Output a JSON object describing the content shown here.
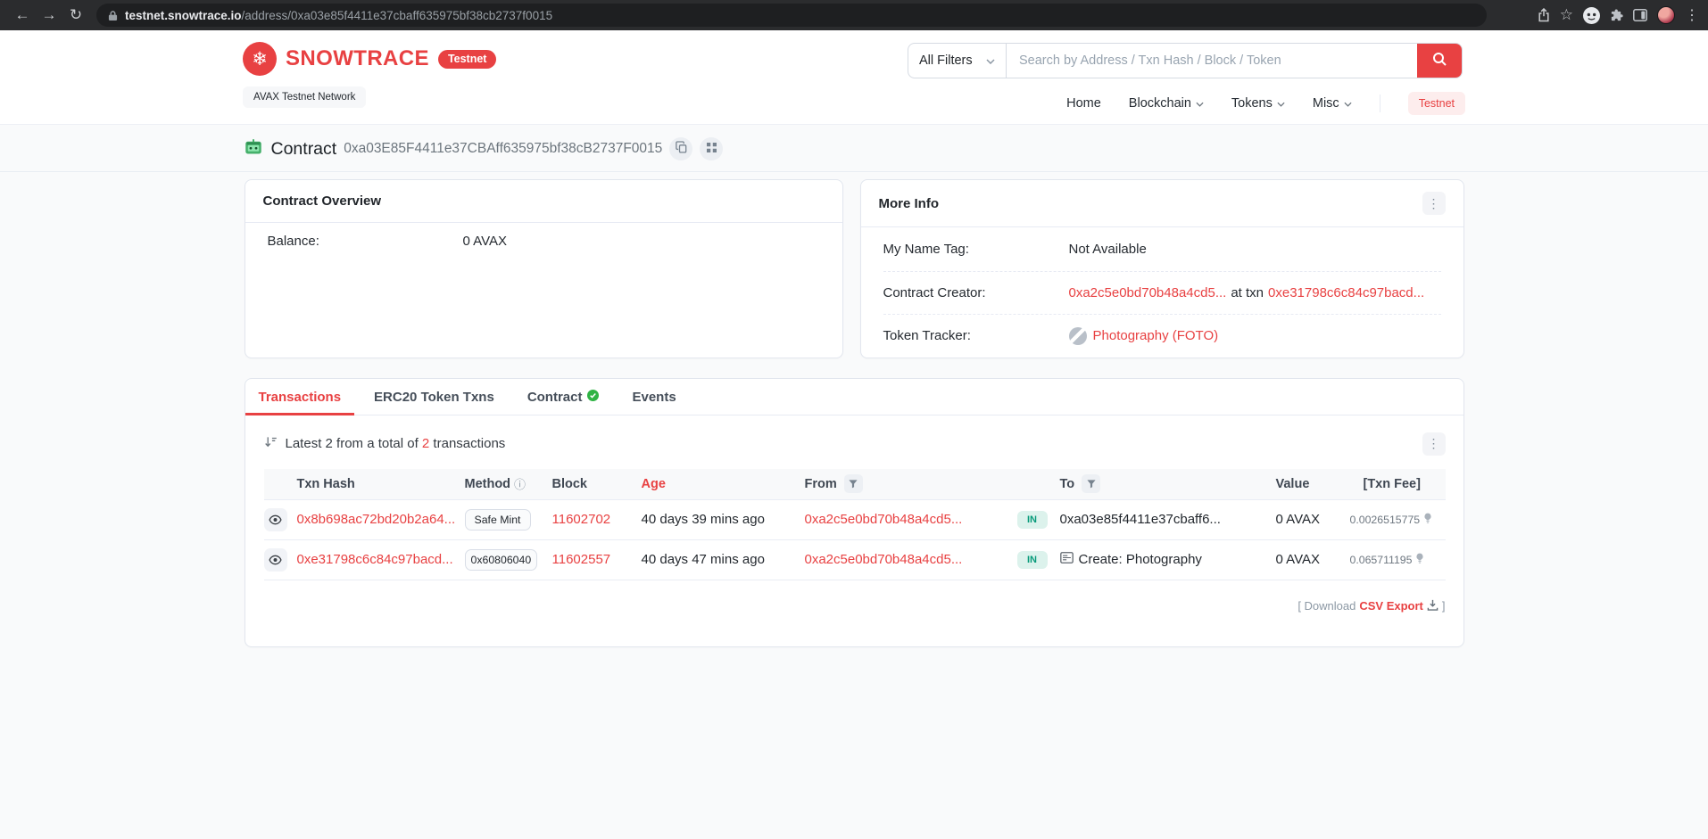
{
  "browser": {
    "url_domain": "testnet.snowtrace.io",
    "url_path": "/address/0xa03e85f4411e37cbaff635975bf38cb2737f0015"
  },
  "icons": {
    "back": "←",
    "forward": "→",
    "refresh": "↻",
    "star": "☆",
    "kebab": "⋮",
    "snowflake": "❄",
    "info": "ⓘ"
  },
  "header": {
    "brand": "SNOWTRACE",
    "brand_badge": "Testnet",
    "network_label": "AVAX Testnet Network",
    "search": {
      "filter_label": "All Filters",
      "placeholder": "Search by Address / Txn Hash / Block / Token"
    },
    "nav": {
      "home": "Home",
      "blockchain": "Blockchain",
      "tokens": "Tokens",
      "misc": "Misc",
      "testnet_badge": "Testnet"
    }
  },
  "page": {
    "title": "Contract",
    "address": "0xa03E85F4411e37CBAff635975bf38cB2737F0015"
  },
  "overview": {
    "title": "Contract Overview",
    "balance_label": "Balance:",
    "balance_value": "0 AVAX"
  },
  "more_info": {
    "title": "More Info",
    "name_tag_label": "My Name Tag:",
    "name_tag_value": "Not Available",
    "creator_label": "Contract Creator:",
    "creator_address": "0xa2c5e0bd70b48a4cd5...",
    "at_txn": "at txn",
    "creator_txn": "0xe31798c6c84c97bacd...",
    "tracker_label": "Token Tracker:",
    "tracker_value": "Photography (FOTO)"
  },
  "tabs": {
    "transactions": "Transactions",
    "erc20": "ERC20 Token Txns",
    "contract": "Contract",
    "events": "Events"
  },
  "transactions": {
    "summary_prefix": "Latest 2 from a total of ",
    "summary_count": "2",
    "summary_suffix": " transactions",
    "headers": {
      "hash": "Txn Hash",
      "method": "Method",
      "block": "Block",
      "age": "Age",
      "from": "From",
      "to": "To",
      "value": "Value",
      "fee": "[Txn Fee]"
    },
    "rows": [
      {
        "hash": "0x8b698ac72bd20b2a64...",
        "method": "Safe Mint",
        "block": "11602702",
        "age": "40 days 39 mins ago",
        "from": "0xa2c5e0bd70b48a4cd5...",
        "direction": "IN",
        "to": "0xa03e85f4411e37cbaff6...",
        "value": "0 AVAX",
        "fee": "0.0026515775"
      },
      {
        "hash": "0xe31798c6c84c97bacd...",
        "method": "0x60806040",
        "block": "11602557",
        "age": "40 days 47 mins ago",
        "from": "0xa2c5e0bd70b48a4cd5...",
        "direction": "IN",
        "to": "Create: Photography",
        "value": "0 AVAX",
        "fee": "0.065711195"
      }
    ],
    "download_open": "[ Download ",
    "download_link": "CSV Export",
    "download_close": " ]"
  },
  "colors": {
    "brand_red": "#e84142",
    "in_badge_bg": "#dcf2ec",
    "in_badge_text": "#079a7a",
    "card_border": "#e2e6ee"
  }
}
